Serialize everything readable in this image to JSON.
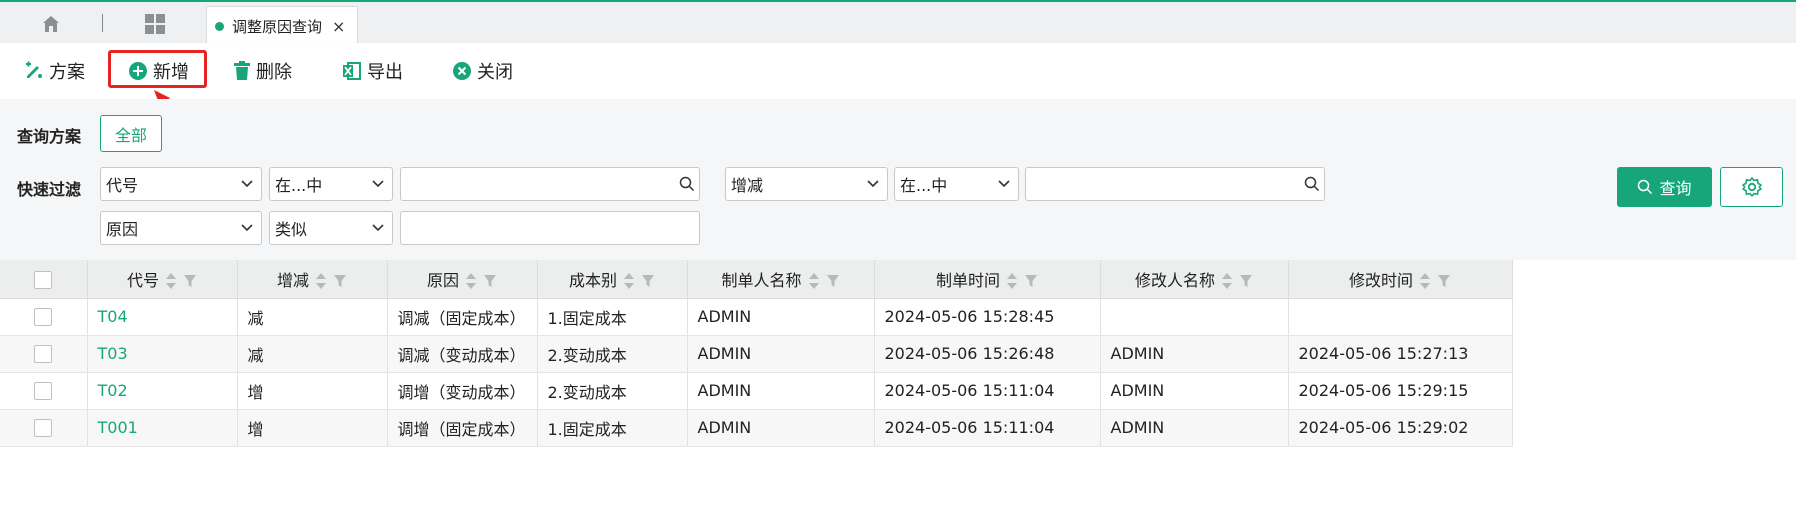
{
  "tabs": {
    "active_label": "调整原因查询",
    "close_symbol": "×"
  },
  "toolbar": {
    "scheme_label": "方案",
    "add_label": "新增",
    "delete_label": "删除",
    "export_label": "导出",
    "close_label": "关闭"
  },
  "filters": {
    "scheme_label": "查询方案",
    "all_label": "全部",
    "quick_label": "快速过滤",
    "row1": {
      "field1": "代号",
      "op1": "在...中",
      "field2": "增减",
      "op2": "在...中"
    },
    "row2": {
      "field1": "原因",
      "op1": "类似"
    },
    "query_label": "查询"
  },
  "table": {
    "headers": [
      "代号",
      "增减",
      "原因",
      "成本别",
      "制单人名称",
      "制单时间",
      "修改人名称",
      "修改时间"
    ],
    "rows": [
      [
        "T04",
        "减",
        "调减（固定成本）",
        "1.固定成本",
        "ADMIN",
        "2024-05-06 15:28:45",
        "",
        ""
      ],
      [
        "T03",
        "减",
        "调减（变动成本）",
        "2.变动成本",
        "ADMIN",
        "2024-05-06 15:26:48",
        "ADMIN",
        "2024-05-06 15:27:13"
      ],
      [
        "T02",
        "增",
        "调增（变动成本）",
        "2.变动成本",
        "ADMIN",
        "2024-05-06 15:11:04",
        "ADMIN",
        "2024-05-06 15:29:15"
      ],
      [
        "T001",
        "增",
        "调增（固定成本）",
        "1.固定成本",
        "ADMIN",
        "2024-05-06 15:11:04",
        "ADMIN",
        "2024-05-06 15:29:02"
      ]
    ]
  },
  "colors": {
    "accent": "#17a67a",
    "highlight": "#e52421"
  }
}
